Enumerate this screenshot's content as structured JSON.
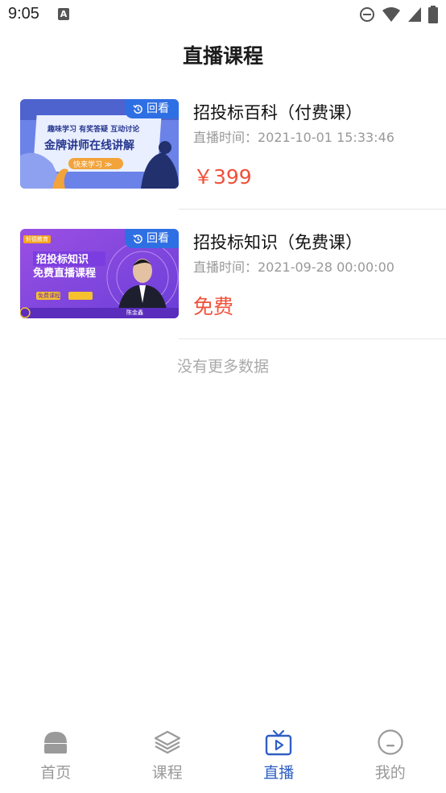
{
  "status_bar": {
    "time": "9:05",
    "notification_icon": "a-icon",
    "icons": [
      "dnd-icon",
      "wifi-icon",
      "signal-icon",
      "battery-icon"
    ]
  },
  "header": {
    "title": "直播课程"
  },
  "courses": [
    {
      "title": "招投标百科（付费课）",
      "time": "直播时间：2021-10-01 15:33:46",
      "price": "￥399",
      "badge": "回看",
      "thumb": {
        "line1": "趣味学习  有奖答疑  互动讨论",
        "line2": "金牌讲师在线讲解",
        "button": "快来学习 ≫"
      }
    },
    {
      "title": "招投标知识（免费课）",
      "time": "直播时间：2021-09-28 00:00:00",
      "price": "免费",
      "badge": "回看",
      "thumb": {
        "tag": "轩德教育",
        "line1": "招投标知识",
        "line2": "免费直播课程",
        "button": "免费课程",
        "person_name": "陈金鑫"
      }
    }
  ],
  "footer_text": "没有更多数据",
  "tabs": [
    {
      "label": "首页",
      "icon": "home-icon"
    },
    {
      "label": "课程",
      "icon": "layers-icon"
    },
    {
      "label": "直播",
      "icon": "live-tv-icon",
      "active": true
    },
    {
      "label": "我的",
      "icon": "profile-icon"
    }
  ],
  "colors": {
    "accent": "#2f5fc4",
    "price": "#f0513a",
    "badge": "#2f6fe4"
  }
}
